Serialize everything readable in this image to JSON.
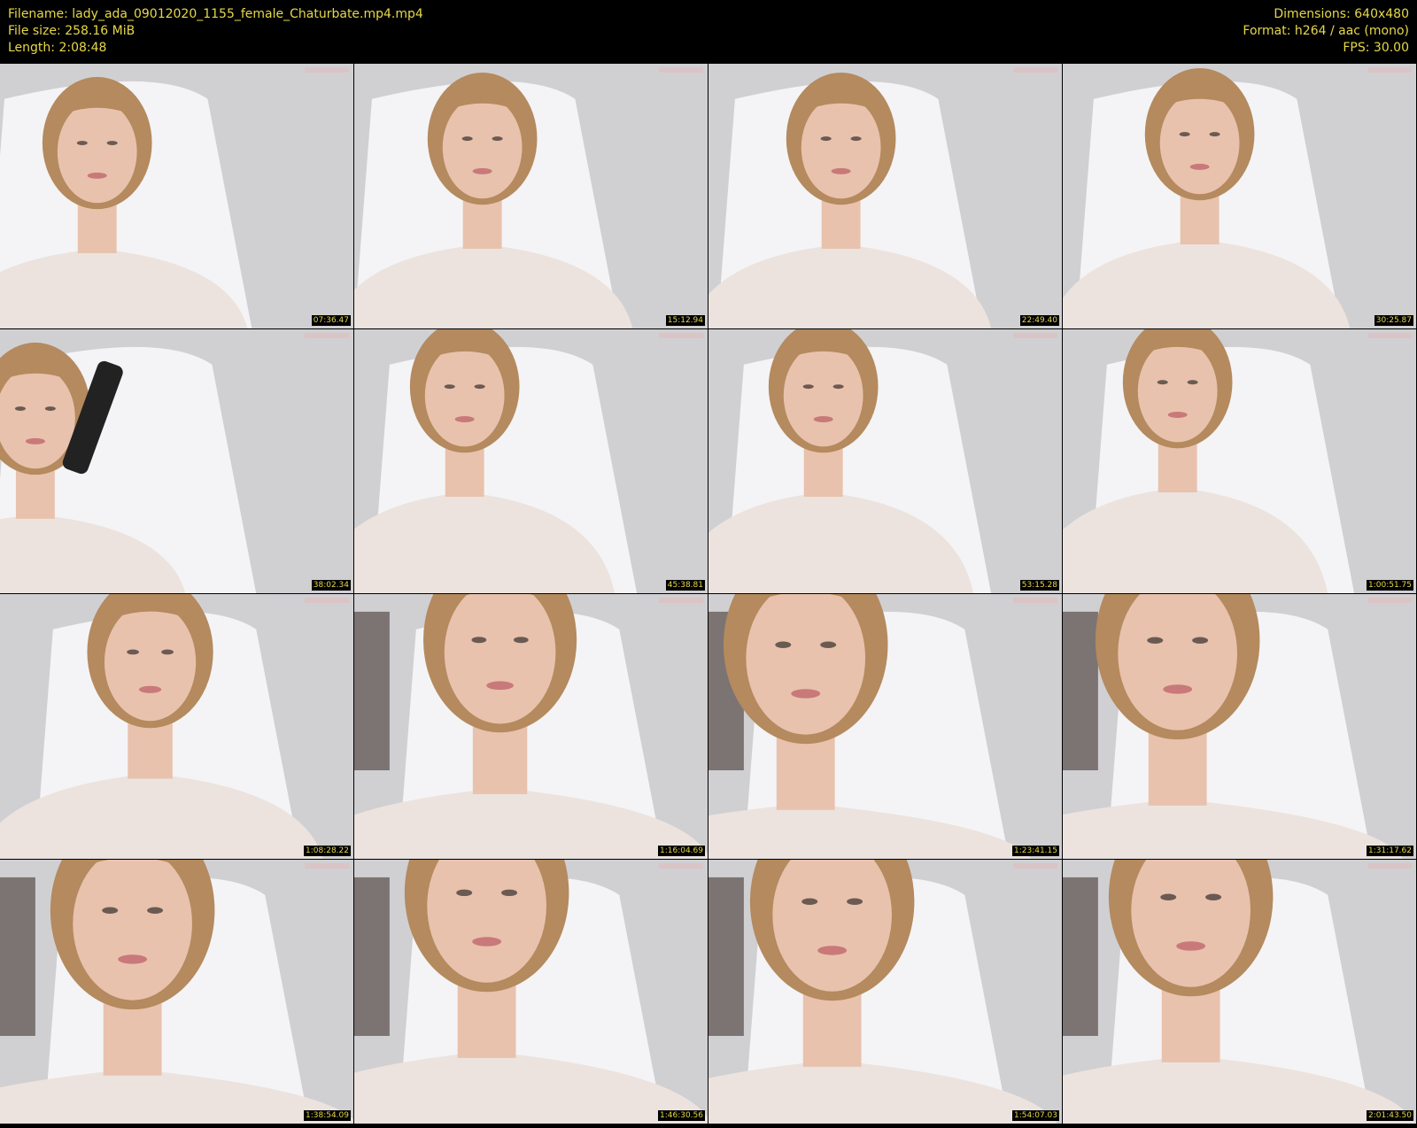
{
  "header": {
    "filename": "Filename: lady_ada_09012020_1155_female_Chaturbate.mp4.mp4",
    "file_size": "File size: 258.16 MiB",
    "length": "Length: 2:08:48",
    "dimensions": "Dimensions: 640x480",
    "format": "Format: h264 / aac (mono)",
    "fps": "FPS: 30.00"
  },
  "thumbnails": [
    {
      "timestamp": "07:36.47"
    },
    {
      "timestamp": "15:12.94"
    },
    {
      "timestamp": "22:49.40"
    },
    {
      "timestamp": "30:25.87"
    },
    {
      "timestamp": "38:02.34"
    },
    {
      "timestamp": "45:38.81"
    },
    {
      "timestamp": "53:15.28"
    },
    {
      "timestamp": "1:00:51.75"
    },
    {
      "timestamp": "1:08:28.22"
    },
    {
      "timestamp": "1:16:04.69"
    },
    {
      "timestamp": "1:23:41.15"
    },
    {
      "timestamp": "1:31:17.62"
    },
    {
      "timestamp": "1:38:54.09"
    },
    {
      "timestamp": "1:46:30.56"
    },
    {
      "timestamp": "1:54:07.03"
    },
    {
      "timestamp": "2:01:43.50"
    }
  ],
  "colors": {
    "header_text": "#e6d84a",
    "background": "#000000",
    "wall": "#d0d0d3",
    "chair": "#f4f4f6",
    "sweater": "#ece3de",
    "skin": "#e8c2ad",
    "hair": "#b48a5e"
  }
}
